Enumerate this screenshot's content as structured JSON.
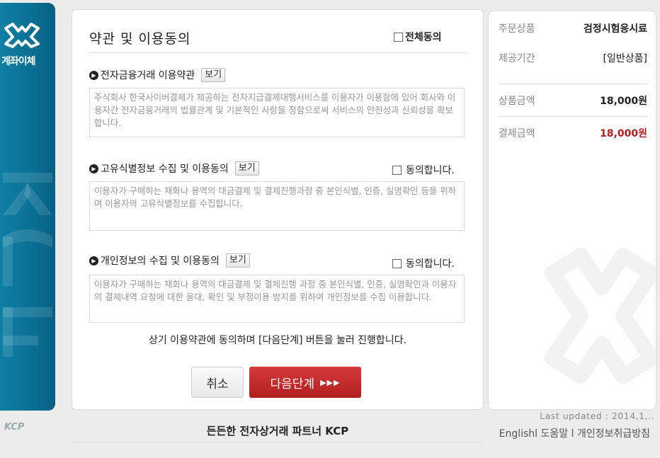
{
  "sidebar": {
    "method_label": "계좌이체",
    "watermark_text": "KCP",
    "logo_text": "KCP"
  },
  "main": {
    "title": "약관 및 이용동의",
    "all_agree_label": "전체동의",
    "sections": [
      {
        "title": "전자금융거래 이용약관",
        "view_label": "보기",
        "text": "주식회사 한국사이버결제가 제공하는 전자지급결제대행서비스를 이용자가 이용함에 있어 회사와 이용자간 전자금융거래의 법률관계 및 기본적인 사항을 정함으로써 서비스의 안전성과 신뢰성을 확보합니다."
      },
      {
        "title": "고유식별정보 수집 및 이용동의",
        "view_label": "보기",
        "agree_label": "동의합니다.",
        "text": "이용자가 구매하는 재화나 용역의 대금결제 및 결제진행과정 중 본인식별, 인증, 실명확인 등을 위하여 이용자의 고유식별정보를 수집합니다."
      },
      {
        "title": "개인정보의 수집 및 이용동의",
        "view_label": "보기",
        "agree_label": "동의합니다.",
        "text": "이용자가 구매하는 재화나 용역의 대금결제 및 결제진행 과정 중 본인식별, 인증, 실명확인과 이용자의 결제내역 요청에 대한 응대, 확인 및 부정이용 방지를 위하여 개인정보를 수집 이용합니다."
      }
    ],
    "notice": "상기 이용약관에 동의하며 [다음단계] 버튼을 눌러 진행합니다.",
    "cancel_label": "취소",
    "next_label": "다음단계",
    "next_arrows": "▶▶▶"
  },
  "summary": {
    "rows": [
      {
        "label": "주문상품",
        "value": "검정시험응시료"
      },
      {
        "label": "제공기간",
        "value": "[일반상품]"
      },
      {
        "label": "상품금액",
        "value": "18,000원"
      },
      {
        "label": "결제금액",
        "value": "18,000원"
      }
    ]
  },
  "footer": {
    "tagline": "든든한 전자상거래 파트너 KCP",
    "last_updated": "Last updated : 2014,1,..",
    "links": [
      "English",
      "도움말",
      "개인정보취급방침"
    ],
    "separator": "l"
  },
  "colors": {
    "sidebar_blue": "#0a6f94",
    "next_button_red": "#c02a2a",
    "amount_red": "#b01e1e"
  }
}
